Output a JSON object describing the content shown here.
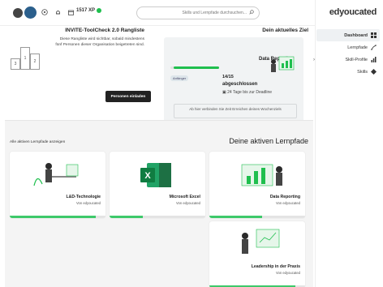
{
  "brand": {
    "name": "edyoucated"
  },
  "sidebar": {
    "items": [
      {
        "label": "Dashboard",
        "icon": "grid-icon"
      },
      {
        "label": "Lernpfade",
        "icon": "path-icon"
      },
      {
        "label": "Skill-Profile",
        "icon": "chart-icon"
      },
      {
        "label": "Skills",
        "icon": "skills-icon"
      }
    ]
  },
  "topbar": {
    "search_placeholder": "Skills und Lernpfade durchsuchen...",
    "xp": "1517 XP"
  },
  "goal": {
    "title": "Dein aktuelles Ziel",
    "name": "Data Reporting",
    "badge": "Anfänger",
    "xp": "14/15",
    "user": "abgeschlossen",
    "due": "24 Tage bis zur Deadline",
    "note": "Ab hier verbinden Sie Zeit Erreichen deines Wochenziels",
    "progress": 0.93
  },
  "rank": {
    "title": "INVITE-ToolCheck 2.0 Rangliste",
    "desc": "Diese Rangliste wird sichtbar, sobald mindestens fünf Personen dieser Organisation beigetreten sind.",
    "button": "Personen einladen",
    "podium": [
      "1",
      "2",
      "3"
    ]
  },
  "learning": {
    "title": "Deine aktiven Lernpfade",
    "link": "Alle aktiven Lernpfade anzeigen",
    "courses": [
      {
        "name": "Data Reporting",
        "meta": "Von edyoucated",
        "progress": 0.55
      },
      {
        "name": "Microsoft Excel",
        "meta": "Von edyoucated",
        "progress": 0.35
      },
      {
        "name": "L&D-Technologie",
        "meta": "Von edyoucated",
        "progress": 0.9
      },
      {
        "name": "Leadership in der Praxis",
        "meta": "Von edyoucated",
        "progress": 0.9
      }
    ]
  },
  "colors": {
    "accent": "#1fbf4e",
    "dark": "#222222",
    "excel": "#1d7044"
  }
}
